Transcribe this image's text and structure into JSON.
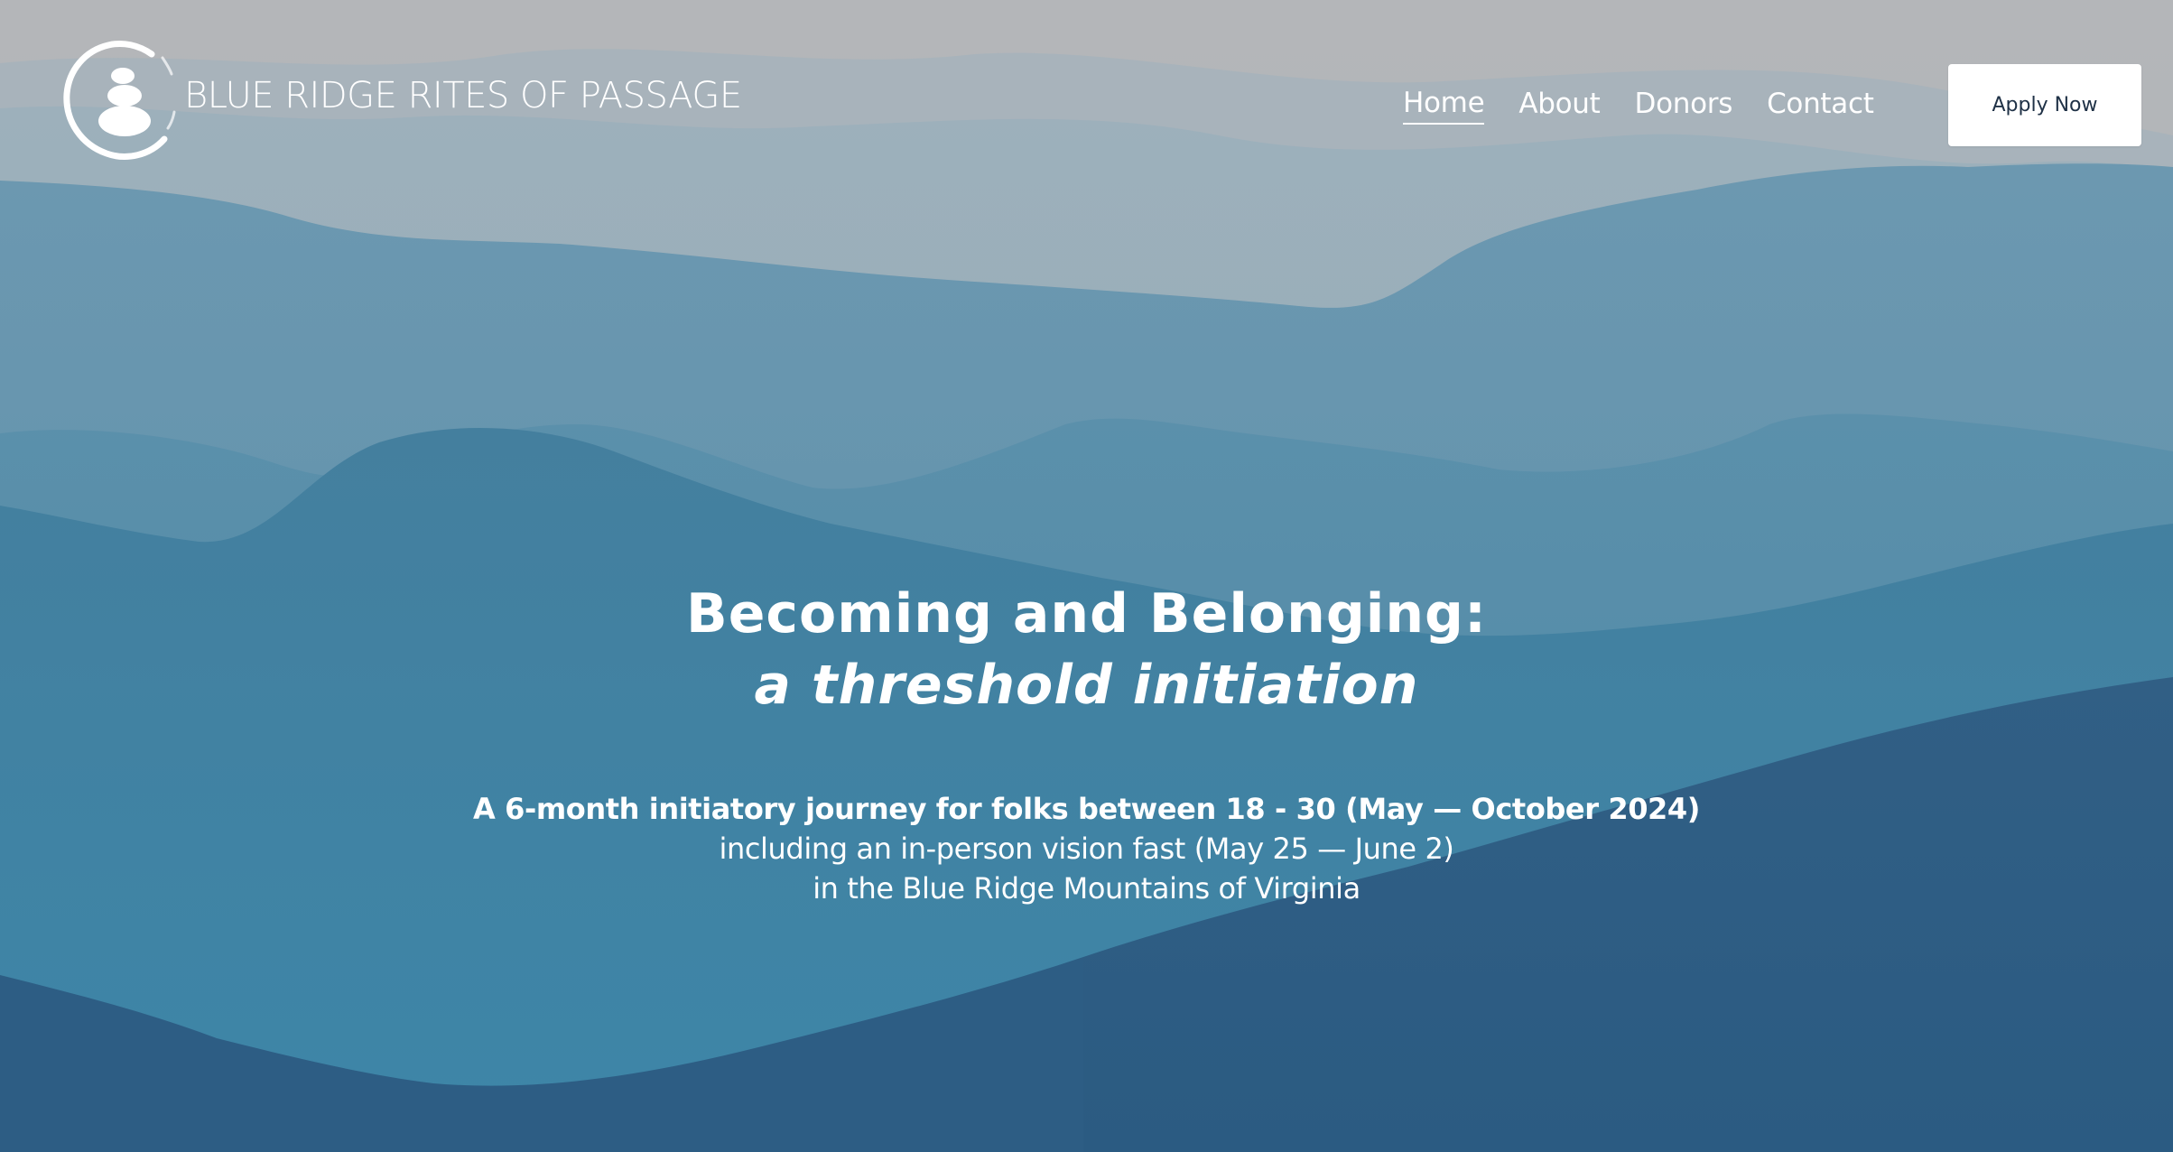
{
  "site": {
    "name": "BLUE RIDGE RITES OF PASSAGE",
    "logo_icon": "stacked-stones-cairn-icon"
  },
  "nav": {
    "items": [
      {
        "label": "Home",
        "active": true
      },
      {
        "label": "About",
        "active": false
      },
      {
        "label": "Donors",
        "active": false
      },
      {
        "label": "Contact",
        "active": false
      }
    ],
    "cta_label": "Apply Now"
  },
  "hero": {
    "title": "Becoming and Belonging:",
    "subtitle": "a threshold initiation",
    "lines": [
      "A 6-month initiatory journey for folks between 18 - 30 (May — October 2024)",
      "including an in-person vision fast (May 25 — June 2)",
      "in the Blue Ridge Mountains of Virginia"
    ]
  },
  "colors": {
    "sky": "#b3b6b9",
    "mountain_far": "#90a9b8",
    "mountain_mid": "#5b8ea9",
    "mountain_near": "#3f7998",
    "mountain_front": "#2c5a80",
    "button_text": "#1f3146",
    "text": "#ffffff"
  }
}
